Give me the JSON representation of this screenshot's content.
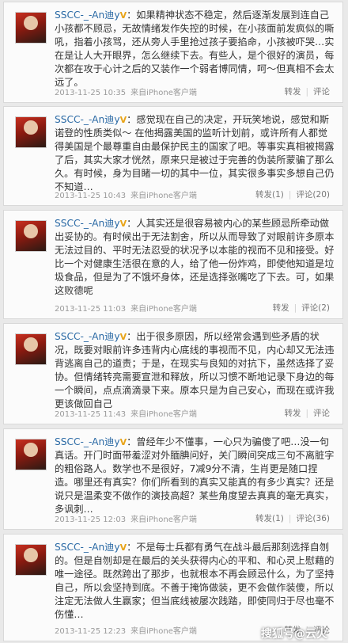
{
  "posts": [
    {
      "username": "SSCC-_-An迪y",
      "badge": "V",
      "text": "：如果精神状态不稳定，然后逐渐发展到连自己小孩都不顾忌，无故情绪发作失控的时候，在小孩面前发疯似的嘶吼，指着小孩骂，还从旁人手里抢过孩子要掐命，小孩被吓哭…实在是让人大开眼界，怎么继续下去。有些人，是个很好的演员，每次都在攻于心计之后的又装作一个弱者博同情，呵～但真相不会太远了。",
      "time": "2013-11-25 10:35",
      "source": "来自iPhone客户端",
      "repost": "转发",
      "comment": "评论"
    },
    {
      "username": "SSCC-_-An迪y",
      "badge": "V",
      "text": "：感觉现在自己的决定，开玩笑地说，感觉和斯诺登的性质类似～ 在他揭露美国的监听计划前，或许所有人都觉得美国是个最尊重自由最保护民主的国家了吧。等事实真相被揭露了后，其实大家才恍然，原来只是被过于完善的伪装所蒙骗了那么久。有时候，身为目睹一切的其中一位，其实很多事实多想自己仍不知道…",
      "time": "2013-11-25 10:43",
      "source": "来自iPhone客户端",
      "repost": "转发(1)",
      "comment": "评论(20)"
    },
    {
      "username": "SSCC-_-An迪y",
      "badge": "V",
      "text": "：人其实还是很容易被内心的某些顾忌所牵动做出妥协的。有时候出于无法割舍，所以从而导致了对眼前许多原本无法过目的、平时无法忍受的状况予以本能的视而不见和接受。好比一个对健康生活很在意的人，给了他一份炸鸡，即使他知道是垃圾食品，但是为了不饿坏身体，还是选择张嘴吃了下去。可，如果这败德呢",
      "time": "2013-11-25 11:03",
      "source": "来自iPhone客户端",
      "repost": "转发",
      "comment": "评论(2)"
    },
    {
      "username": "SSCC-_-An迪y",
      "badge": "V",
      "text": "：出于很多原因，所以经常会遇到些矛盾的状况，既要对眼前许多违背内心底线的事视而不见，内心却又无法违背逃离自己的道责；于是，在现实与良知的对抗下，虽然选择了妥协。但情绪转亮需要宣泄和释放，所以习惯不断地记录下身边的每一个瞬间，点点滴滴录下来。原本只是为自己安心，而现在或许我更该做回自己",
      "time": "2013-11-25 11:43",
      "source": "来自iPhone客户端",
      "repost": "转发",
      "comment": "评论"
    },
    {
      "username": "SSCC-_-An迪y",
      "badge": "V",
      "text": "：曾经年少不懂事，一心只为骗傻了吧…没一句真话。开门时面带羞涩对外腼腆问好，关门瞬间突成三句不离脏字的粗俗路人。数学也不是很好，7减9分不清，生肖更是随口捏造。哪里还有真实？你们所看到的真实又能真的有多少真实？还是说只是温柔变不做作的演技高超？某些角度望去真真的毫无真实，多讽刺…",
      "time": "2013-11-25 12:03",
      "source": "来自iPhone客户端",
      "repost": "转发(1)",
      "comment": "评论(36)"
    },
    {
      "username": "SSCC-_-An迪y",
      "badge": "V",
      "text": "：不是每士兵都有勇气在战斗最后那刻选择自刎的。但是自刎却是在最后的关头获得内心的平和、和心灵上慰藉的唯一途径。既然跨出了那步，也就根本不再会顾忌什么，为了坚持自己，所以会坚持到底。不善于掩饰做装，更不会做作装傻，所以注定无法做人生赢家；但当底线被屡次践踏，即使同归于尽也毫不伤懂…",
      "time": "2013-11-25 12:23",
      "source": "来自iPhone客户端",
      "repost": "转发",
      "comment": "评论"
    }
  ],
  "watermark": "搜狐号@云火"
}
